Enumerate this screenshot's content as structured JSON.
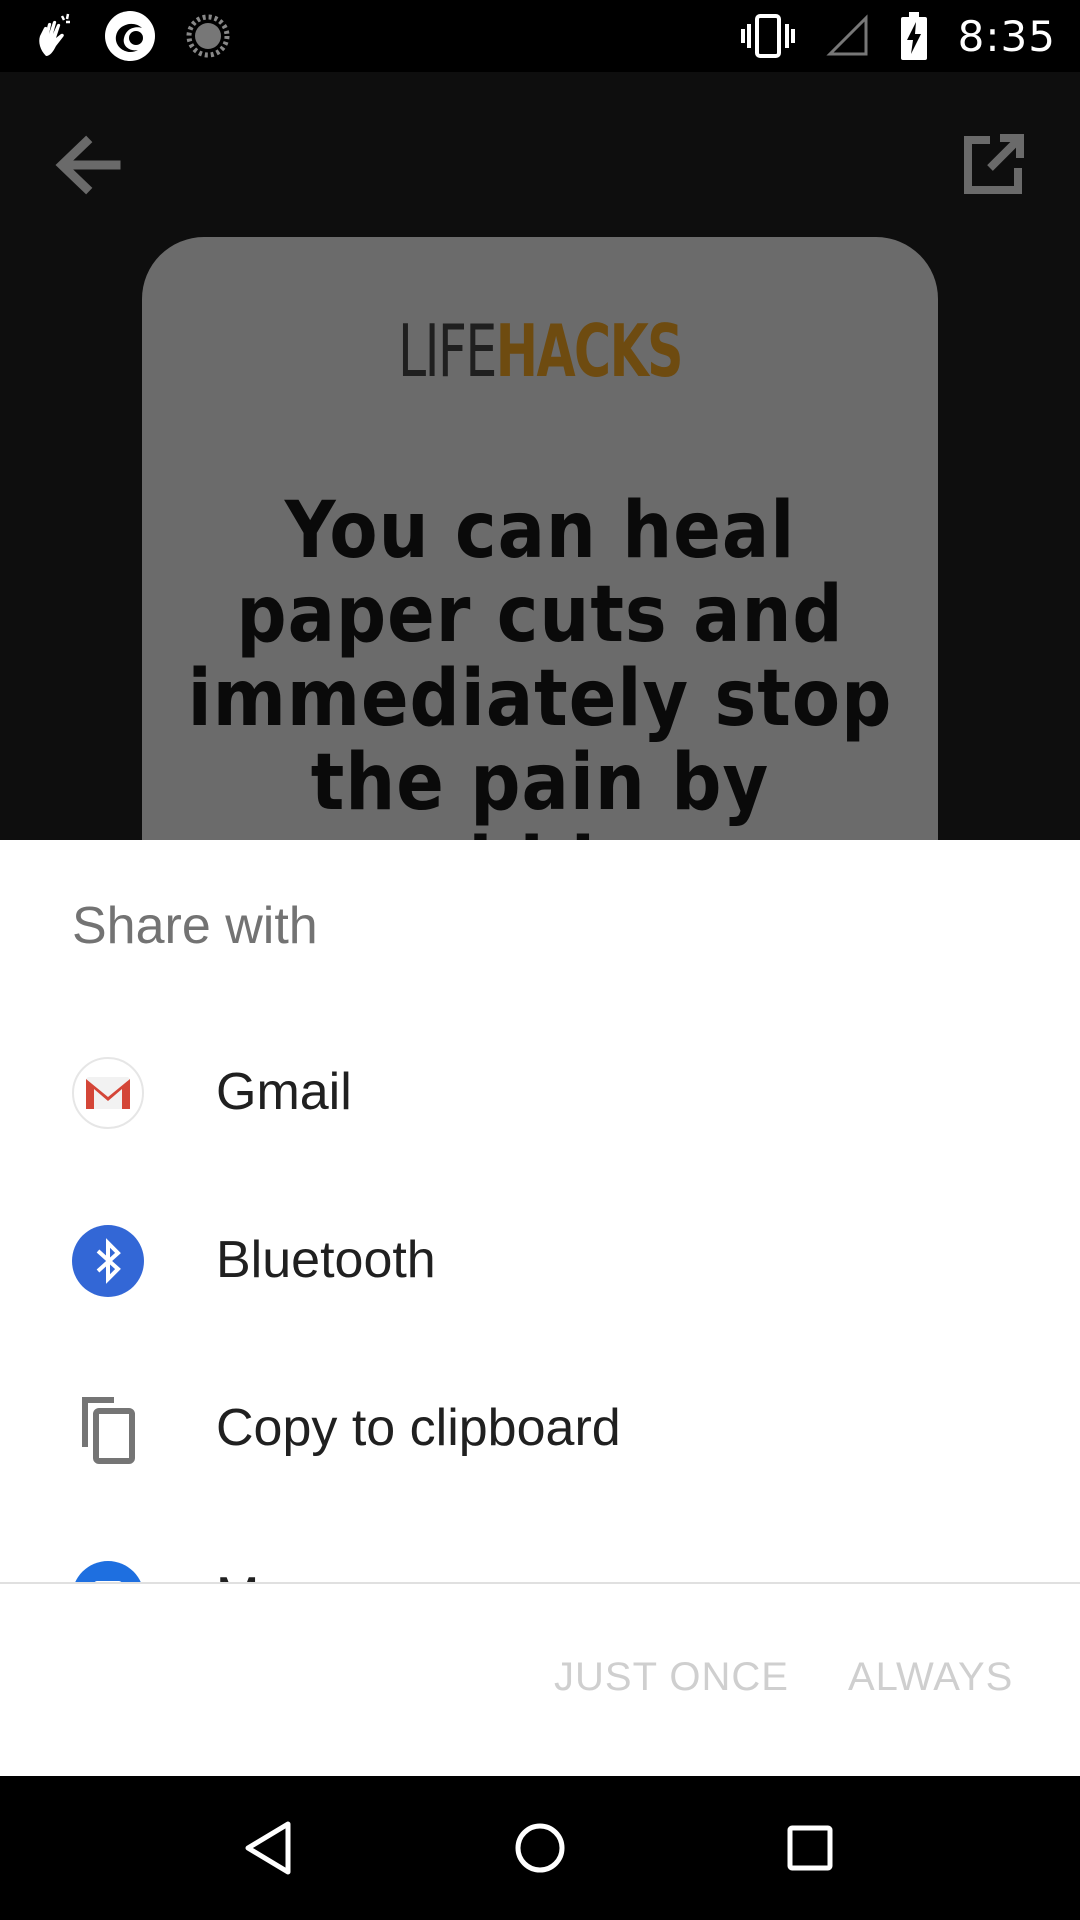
{
  "status_bar": {
    "time": "8:35",
    "left_icons": [
      "gesture-icon",
      "app-circle-icon",
      "loading-icon"
    ],
    "right_icons": [
      "vibrate-icon",
      "signal-icon",
      "battery-charging-icon"
    ]
  },
  "background_app": {
    "brand_life": "LIFE",
    "brand_hacks": "HACKS",
    "fact_text": "You can heal paper cuts and immediately stop the pain by rubbing"
  },
  "share_sheet": {
    "title": "Share with",
    "items": [
      {
        "label": "Gmail",
        "icon": "gmail-icon"
      },
      {
        "label": "Bluetooth",
        "icon": "bluetooth-icon"
      },
      {
        "label": "Copy to clipboard",
        "icon": "copy-icon"
      },
      {
        "label": "M",
        "icon": "messages-icon"
      }
    ],
    "just_once_label": "JUST ONCE",
    "always_label": "ALWAYS"
  },
  "colors": {
    "brand_accent": "#6e4b10",
    "bluetooth_blue": "#3367d6",
    "disabled_text": "#cfcfcf"
  }
}
